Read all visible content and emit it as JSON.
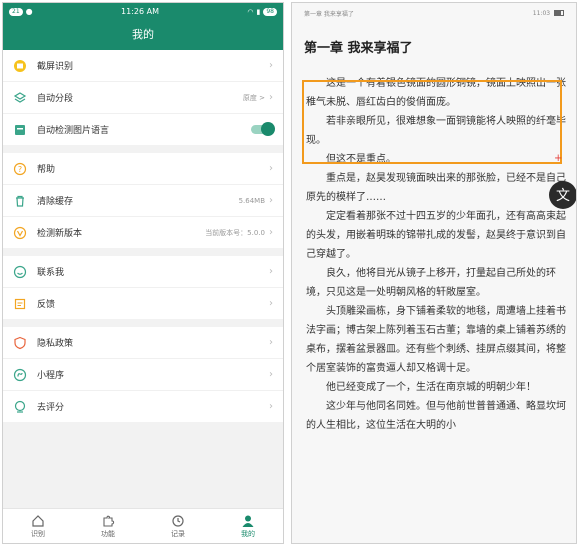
{
  "left": {
    "status": {
      "badge1": "21",
      "time": "11:26 AM",
      "battery": "98"
    },
    "header_title": "我的",
    "groups": [
      [
        {
          "label": "截屏识别",
          "value": "",
          "icon": "screenshot-icon"
        },
        {
          "label": "自动分段",
          "value": "原度 >",
          "icon": "layers-icon"
        },
        {
          "label": "自动检测图片语言",
          "value": "",
          "icon": "image-language-icon",
          "toggle": true
        }
      ],
      [
        {
          "label": "帮助",
          "value": "",
          "icon": "help-icon"
        },
        {
          "label": "清除缓存",
          "value": "5.64MB",
          "icon": "trash-icon"
        },
        {
          "label": "检测新版本",
          "value": "当前版本号：5.0.0",
          "icon": "version-icon"
        }
      ],
      [
        {
          "label": "联系我",
          "value": "",
          "icon": "contact-icon"
        },
        {
          "label": "反馈",
          "value": "",
          "icon": "feedback-icon"
        }
      ],
      [
        {
          "label": "隐私政策",
          "value": "",
          "icon": "privacy-icon"
        },
        {
          "label": "小程序",
          "value": "",
          "icon": "mini-program-icon"
        },
        {
          "label": "去评分",
          "value": "",
          "icon": "rate-icon"
        }
      ]
    ],
    "tabs": [
      {
        "label": "识别",
        "icon": "home-icon",
        "active": false
      },
      {
        "label": "功能",
        "icon": "puzzle-icon",
        "active": false
      },
      {
        "label": "记录",
        "icon": "clock-icon",
        "active": false
      },
      {
        "label": "我的",
        "icon": "person-icon",
        "active": true
      }
    ]
  },
  "right": {
    "top_left": "第一章 我来享福了",
    "top_time": "11:03",
    "chapter_title": "第一章 我来享福了",
    "paragraphs": [
      "这是一个有着银色镜面的圆形铜镜，镜面上映照出一张稚气未脱、唇红齿白的俊俏面庞。",
      "若非亲眼所见，很难想象一面铜镜能将人映照的纤毫毕现。",
      "但这不是重点。",
      "重点是，赵昊发现镜面映出来的那张脸，已经不是自己原先的模样了……",
      "定定看着那张不过十四五岁的少年面孔，还有高高束起的头发，用嵌着明珠的锦带扎成的发髻，赵昊终于意识到自己穿越了。",
      "良久，他将目光从镜子上移开，打量起自己所处的环境，只见这是一处明朝风格的轩敞屋室。",
      "头顶雕梁画栋，身下铺着柔软的地毯，周遭墙上挂着书法字画；博古架上陈列着玉石古董；靠墙的桌上铺着苏绣的桌布，摆着盆景器皿。还有些个刺绣、挂屏点缀其间，将整个居室装饰的富贵逼人却又格调十足。",
      "他已经变成了一个，生活在南京城的明朝少年！",
      "这少年与他同名同姓。但与他前世普普通通、略显坎坷的人生相比，这位生活在大明的小"
    ],
    "translate_label": "文"
  },
  "colors": {
    "brand": "#1a8a6c",
    "highlight": "#f29a1d"
  }
}
